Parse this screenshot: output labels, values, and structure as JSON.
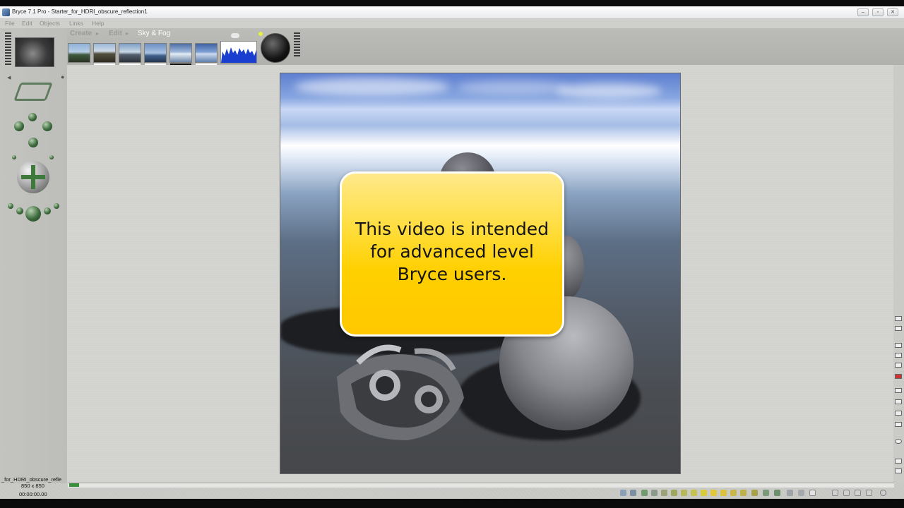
{
  "window": {
    "title": "Bryce 7.1  Pro - Starter_for_HDRI_obscure_reflection1",
    "minimize_glyph": "–",
    "maximize_glyph": "▫",
    "close_glyph": "✕"
  },
  "menu": {
    "items": [
      {
        "label": "File"
      },
      {
        "label": "Edit"
      },
      {
        "label": "Objects"
      },
      {
        "label": "Links"
      },
      {
        "label": "Help"
      }
    ]
  },
  "palette": {
    "tabs": {
      "create": "Create",
      "edit": "Edit",
      "sky_fog": "Sky & Fog"
    },
    "create_arrow": "▸",
    "edit_arrow": "▸"
  },
  "callout": {
    "text": "This video is intended for advanced level Bryce users."
  },
  "status": {
    "file_name": "_for_HDRI_obscure_refle",
    "size": "850 x 850",
    "time": "00:00:00.00"
  },
  "colors": {
    "callout_fill": "#ffd000",
    "accent_green": "#3d6b3c",
    "workspace": "#d4d4d1"
  },
  "icons": {
    "app": "bryce-app-icon",
    "sun": "sun-control-icon",
    "cloud": "cloud-icon"
  }
}
